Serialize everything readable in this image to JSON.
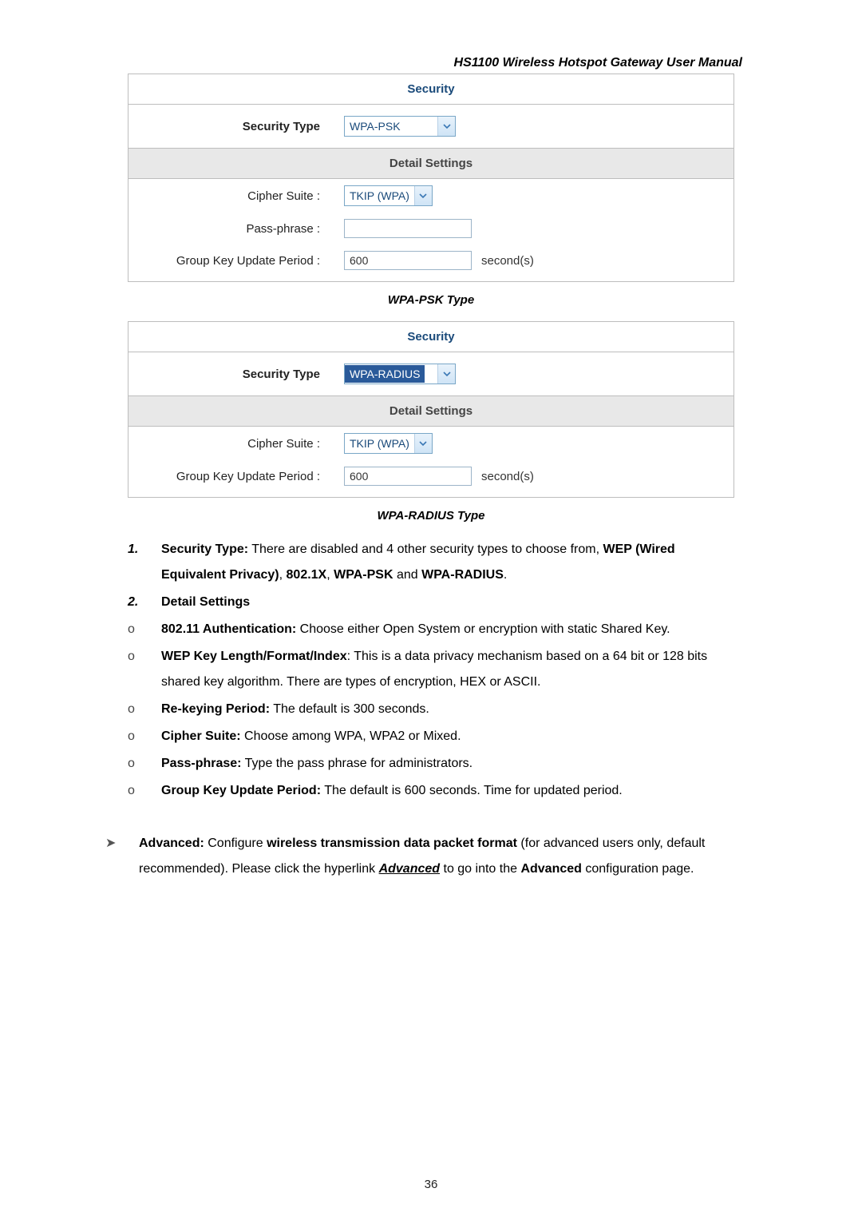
{
  "header": {
    "title": "HS1100 Wireless Hotspot Gateway User Manual"
  },
  "panel1": {
    "security_header": "Security",
    "security_type_label": "Security Type",
    "security_type_value": "WPA-PSK",
    "detail_header": "Detail Settings",
    "cipher_label": "Cipher Suite :",
    "cipher_value": "TKIP (WPA)",
    "pass_label": "Pass-phrase :",
    "pass_value": "",
    "gkup_label": "Group Key Update Period :",
    "gkup_value": "600",
    "gkup_unit": "second(s)"
  },
  "caption1": "WPA-PSK Type",
  "panel2": {
    "security_header": "Security",
    "security_type_label": "Security Type",
    "security_type_value": "WPA-RADIUS",
    "detail_header": "Detail Settings",
    "cipher_label": "Cipher Suite :",
    "cipher_value": "TKIP (WPA)",
    "gkup_label": "Group Key Update Period :",
    "gkup_value": "600",
    "gkup_unit": "second(s)"
  },
  "caption2": "WPA-RADIUS Type",
  "text": {
    "l1_a": "Security Type:",
    "l1_b": " There are disabled and 4 other security types to choose from, ",
    "l1_c": "WEP (Wired Equivalent Privacy)",
    "l1_d": ", ",
    "l1_e": "802.1X",
    "l1_f": ", ",
    "l1_g": "WPA-PSK",
    "l1_h": " and ",
    "l1_i": "WPA-RADIUS",
    "l1_j": ".",
    "l2": "Detail Settings",
    "b1_a": "802.11 Authentication:",
    "b1_b": " Choose either Open System or encryption with static Shared Key.",
    "b2_a": "WEP Key Length/Format/Index",
    "b2_b": ": This is a data privacy mechanism based on a 64 bit or 128 bits shared key algorithm. There are types of encryption, HEX or ASCII.",
    "b3_a": "Re-keying Period:",
    "b3_b": " The default is 300 seconds.",
    "b4_a": "Cipher Suite:",
    "b4_b": " Choose among WPA, WPA2 or Mixed.",
    "b5_a": "Pass-phrase:",
    "b5_b": " Type the pass phrase for administrators.",
    "b6_a": "Group Key Update Period:",
    "b6_b": " The default is 600 seconds. Time for updated period.",
    "adv_a": "Advanced:",
    "adv_b": " Configure ",
    "adv_c": "wireless transmission data packet format",
    "adv_d": " (for advanced users only, default recommended). Please click the hyperlink ",
    "adv_e": "Advanced",
    "adv_f": " to go into the ",
    "adv_g": "Advanced",
    "adv_h": " configuration page."
  },
  "page_number": "36"
}
